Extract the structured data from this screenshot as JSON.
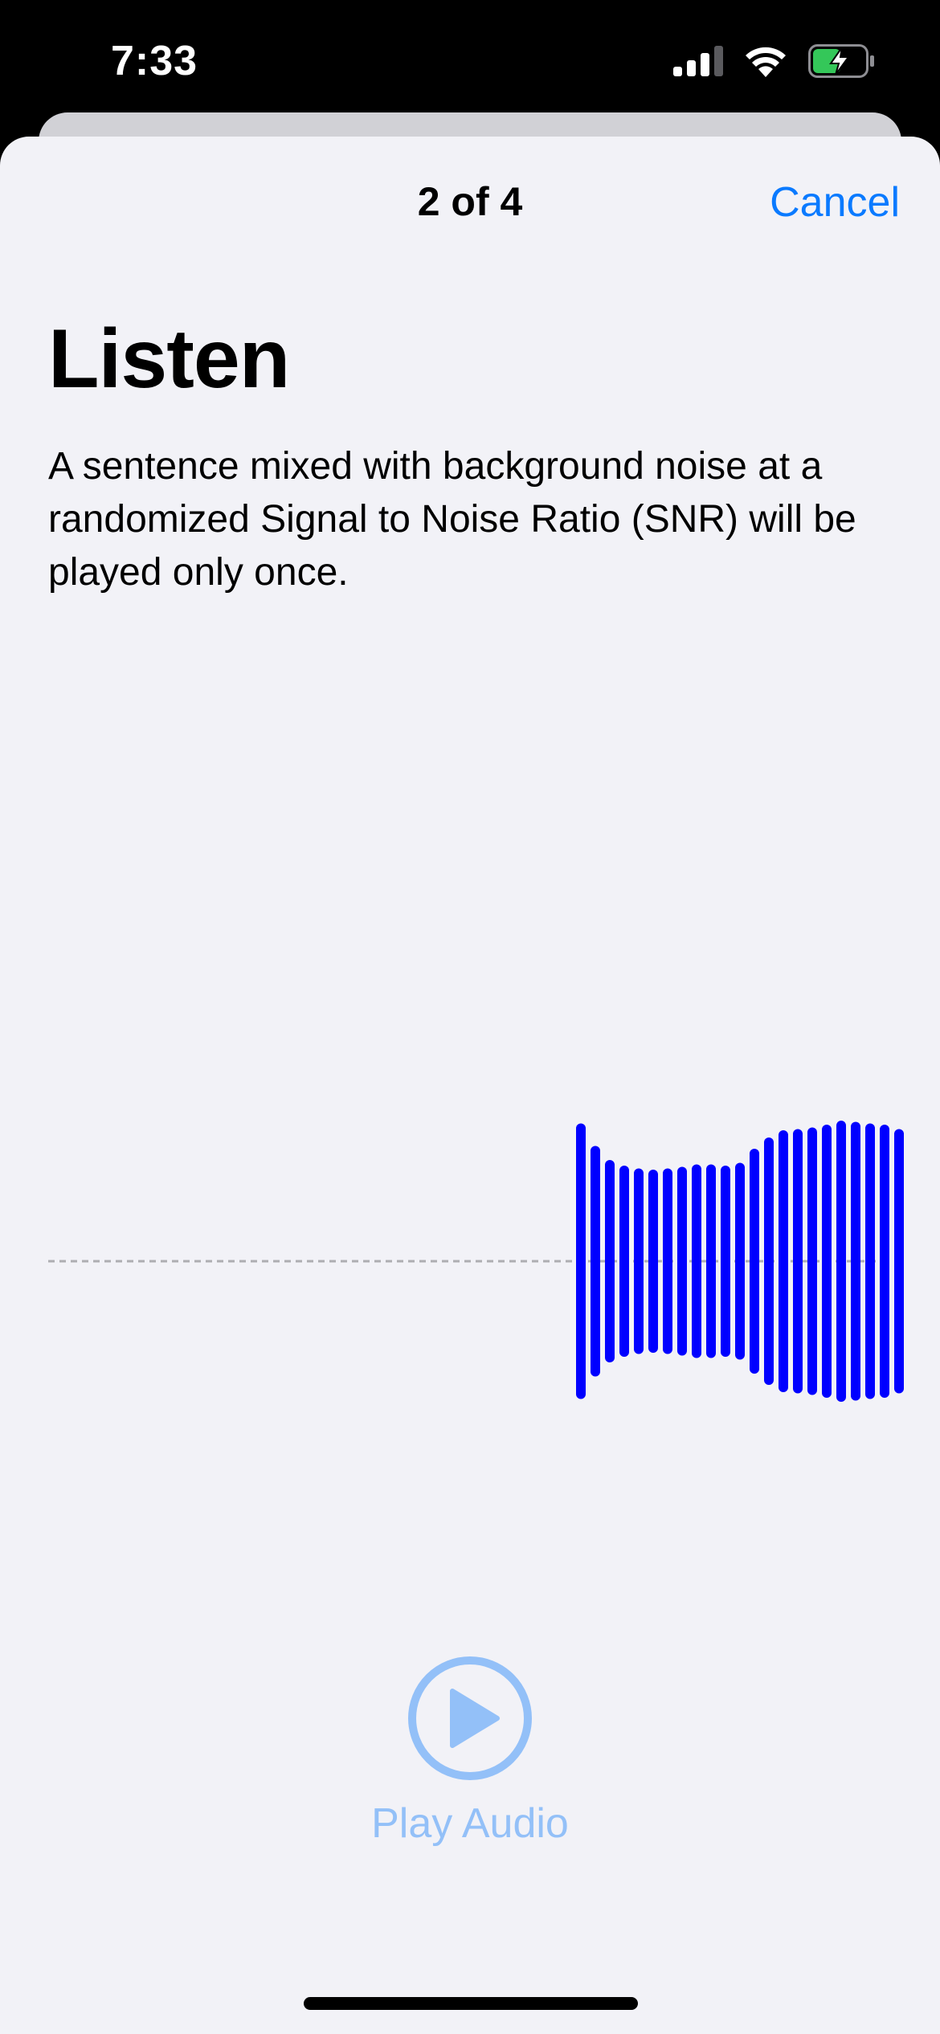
{
  "status_bar": {
    "time": "7:33",
    "icons": [
      "cellular-signal-icon",
      "wifi-icon",
      "battery-charging-icon"
    ]
  },
  "nav": {
    "step": "2 of 4",
    "cancel_label": "Cancel"
  },
  "content": {
    "title": "Listen",
    "description": "A sentence mixed with background noise at a randomized Signal to Noise Ratio (SNR) will be played only once."
  },
  "waveform": {
    "color": "#0000ff",
    "baseline_color": "#aeaeb2",
    "levels": [
      0.98,
      0.82,
      0.72,
      0.68,
      0.66,
      0.65,
      0.66,
      0.67,
      0.69,
      0.69,
      0.68,
      0.7,
      0.8,
      0.88,
      0.93,
      0.94,
      0.95,
      0.97,
      1.0,
      0.99,
      0.98,
      0.97,
      0.94
    ]
  },
  "player": {
    "play_label": "Play Audio",
    "accent_color": "#93c0f8"
  }
}
